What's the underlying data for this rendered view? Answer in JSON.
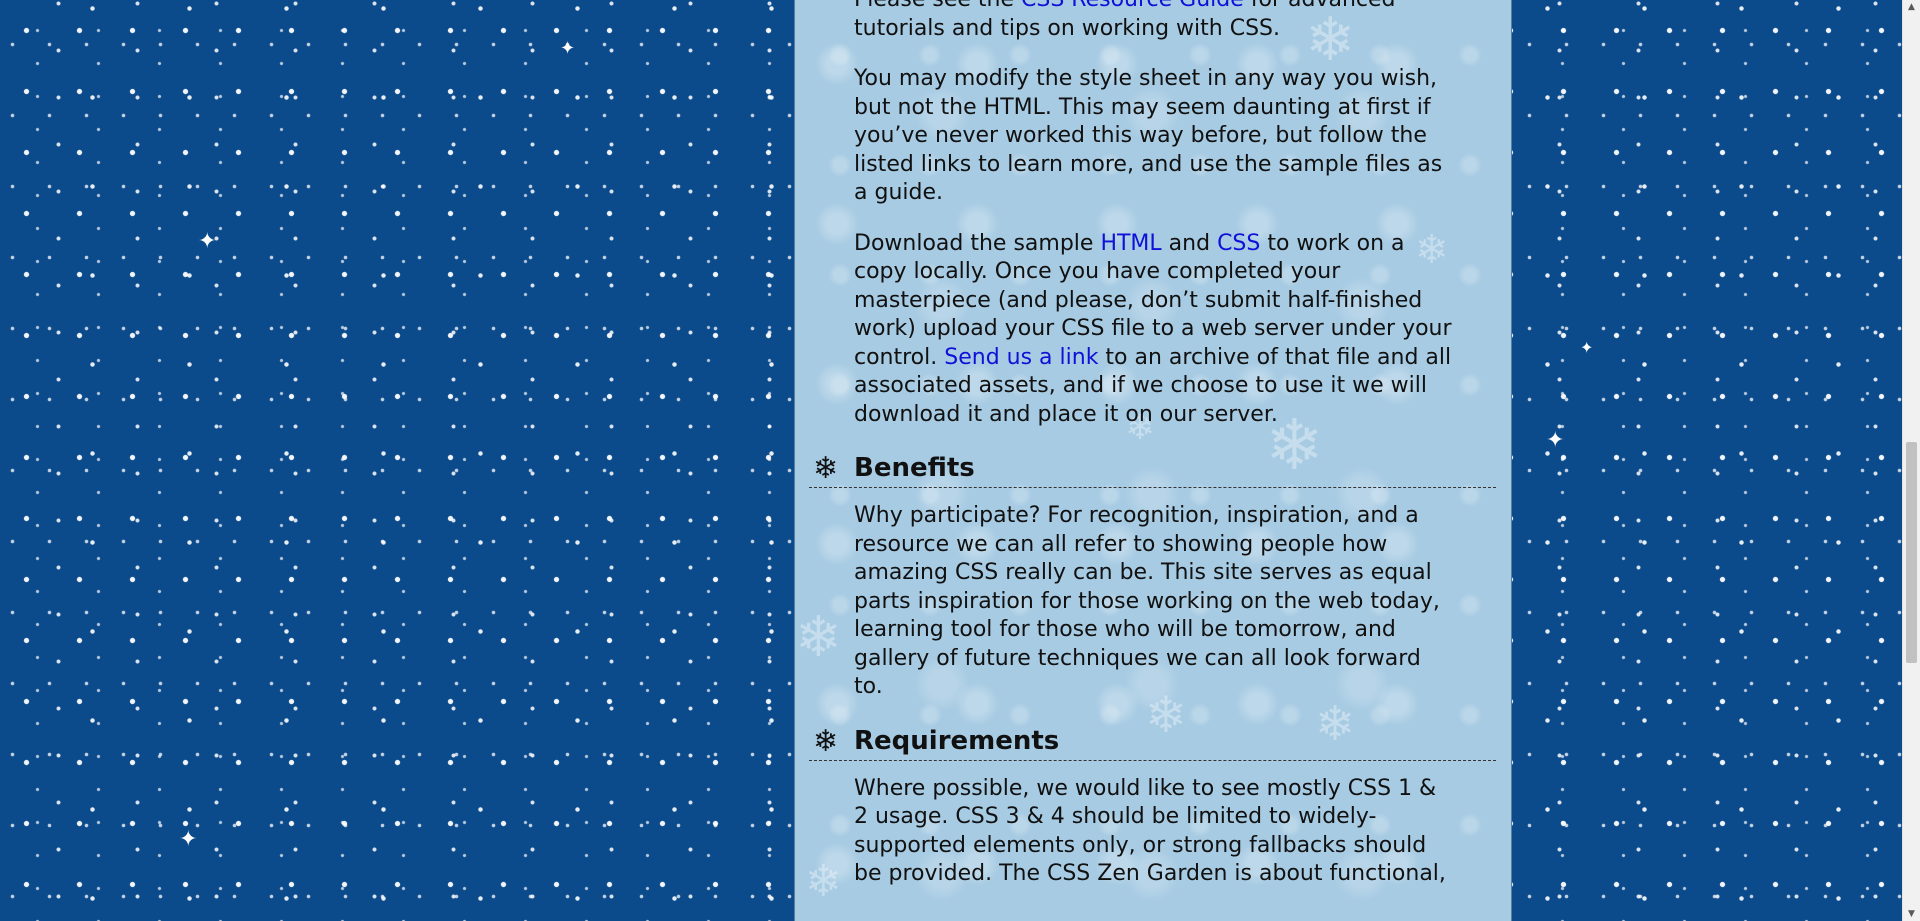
{
  "page": {
    "background_color": "#0b4a8b",
    "column_color": "#a7cbe3",
    "link_color": "#1010d8"
  },
  "paragraphs": {
    "resource": {
      "before": "Please see the ",
      "link": "CSS Resource Guide",
      "after": " for advanced tutorials and tips on working with CSS."
    },
    "modify": "You may modify the style sheet in any way you wish, but not the HTML. This may seem daunting at first if you’ve never worked this way before, but follow the listed links to learn more, and use the sample files as a guide.",
    "download": {
      "part1": "Download the sample ",
      "link_html": "HTML",
      "part2": " and ",
      "link_css": "CSS",
      "part3": " to work on a copy locally. Once you have completed your masterpiece (and please, don’t submit half-finished work) upload your CSS file to a web server under your control. ",
      "link_send": "Send us a link",
      "part4": " to an archive of that file and all associated assets, and if we choose to use it we will download it and place it on our server."
    },
    "benefits": "Why participate? For recognition, inspiration, and a resource we can all refer to showing people how amazing CSS really can be. This site serves as equal parts inspiration for those working on the web today, learning tool for those who will be tomorrow, and gallery of future techniques we can all look forward to.",
    "requirements": "Where possible, we would like to see mostly CSS 1 & 2 usage. CSS 3 & 4 should be limited to widely-supported elements only, or strong fallbacks should be provided. The CSS Zen Garden is about functional,"
  },
  "headings": {
    "benefits": "Benefits",
    "requirements": "Requirements"
  },
  "icons": {
    "heading_icon": "snowflake-icon",
    "scroll_up": "scroll-up-arrow-icon",
    "scroll_down": "scroll-down-arrow-icon"
  }
}
